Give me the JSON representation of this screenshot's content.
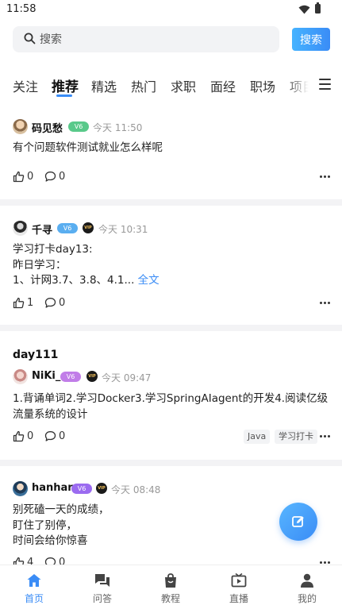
{
  "status_bar": {
    "time": "11:58"
  },
  "search": {
    "placeholder": "搜索",
    "button_label": "搜索"
  },
  "tabs": [
    {
      "label": "关注"
    },
    {
      "label": "推荐",
      "active": true
    },
    {
      "label": "精选"
    },
    {
      "label": "热门"
    },
    {
      "label": "求职"
    },
    {
      "label": "面经"
    },
    {
      "label": "职场"
    },
    {
      "label": "项目"
    }
  ],
  "posts": [
    {
      "user": "码见愁",
      "level": "V6",
      "time": "今天 11:50",
      "content": "有个问题软件测试就业怎么样呢",
      "likes": "0",
      "comments": "0"
    },
    {
      "user": "千寻",
      "level": "V6",
      "vip": "VIP",
      "time": "今天 10:31",
      "content_lines": [
        "学习打卡day13:",
        "昨日学习：",
        "1、计网3.7、3.8、4.1..."
      ],
      "more_label": "全文",
      "likes": "1",
      "comments": "0"
    },
    {
      "title": "day111",
      "user": "NiKi_",
      "level": "V6",
      "vip": "VIP",
      "time": "今天 09:47",
      "content": "1.背诵单词2.学习Docker3.学习SpringAIagent的开发4.阅读亿级流量系统的设计",
      "likes": "0",
      "comments": "0",
      "tags": [
        "Java",
        "学习打卡"
      ]
    },
    {
      "user": "hanhan",
      "level": "V6",
      "vip": "VIP",
      "time": "今天 08:48",
      "content_lines": [
        "别死磕一天的成绩，",
        "盯住了别停，",
        "时间会给你惊喜"
      ],
      "likes": "4",
      "comments": "0"
    }
  ],
  "bottom_nav": [
    {
      "label": "首页",
      "icon": "home-icon",
      "active": true
    },
    {
      "label": "问答",
      "icon": "chat-icon"
    },
    {
      "label": "教程",
      "icon": "bag-icon"
    },
    {
      "label": "直播",
      "icon": "tv-icon"
    },
    {
      "label": "我的",
      "icon": "person-icon"
    }
  ],
  "colors": {
    "accent": "#3a8cf6",
    "divider": "#f3f3f5",
    "level_green": "#59c98a",
    "level_blue": "#5aaef0",
    "level_purple": "#c17de8",
    "level_violet": "#9b6bf0"
  }
}
